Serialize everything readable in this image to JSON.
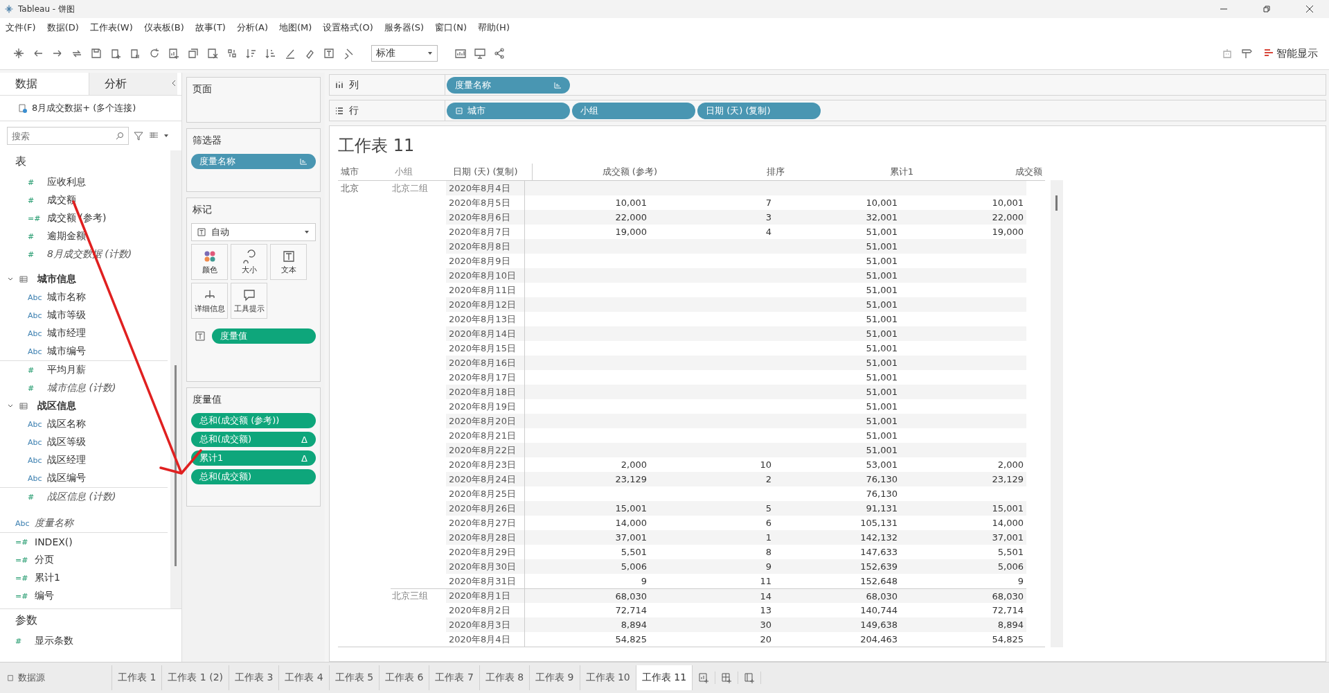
{
  "window": {
    "title": "Tableau - 饼图"
  },
  "menu": [
    "文件(F)",
    "数据(D)",
    "工作表(W)",
    "仪表板(B)",
    "故事(T)",
    "分析(A)",
    "地图(M)",
    "设置格式(O)",
    "服务器(S)",
    "窗口(N)",
    "帮助(H)"
  ],
  "toolbar": {
    "fit": "标准",
    "show_me": "智能显示"
  },
  "data_pane": {
    "tabs": [
      {
        "label": "数据",
        "selected": true
      },
      {
        "label": "分析",
        "selected": false
      }
    ],
    "source": "8月成交数据+ (多个连接)",
    "search": {
      "placeholder": "搜索"
    },
    "section": "表",
    "fields": [
      {
        "kind": "measure",
        "icon": "#",
        "label": "应收利息",
        "generated": false
      },
      {
        "kind": "measure",
        "icon": "#",
        "label": "成交额",
        "generated": false
      },
      {
        "kind": "calc",
        "icon": "=#",
        "label": "成交额 (参考)",
        "generated": false
      },
      {
        "kind": "measure",
        "icon": "#",
        "label": "逾期金额",
        "generated": false
      },
      {
        "kind": "measure",
        "icon": "#",
        "label": "8月成交数据 (计数)",
        "generated": true
      },
      {
        "kind": "folder",
        "label": "城市信息",
        "expanded": true,
        "children": [
          {
            "kind": "dimension",
            "icon": "Abc",
            "label": "城市名称",
            "generated": false
          },
          {
            "kind": "dimension",
            "icon": "Abc",
            "label": "城市等级",
            "generated": false
          },
          {
            "kind": "dimension",
            "icon": "Abc",
            "label": "城市经理",
            "generated": false
          },
          {
            "kind": "dimension",
            "icon": "Abc",
            "label": "城市编号",
            "generated": false
          },
          {
            "kind": "measure",
            "icon": "#",
            "label": "平均月薪",
            "generated": false
          },
          {
            "kind": "measure",
            "icon": "#",
            "label": "城市信息 (计数)",
            "generated": true
          }
        ]
      },
      {
        "kind": "folder",
        "label": "战区信息",
        "expanded": true,
        "children": [
          {
            "kind": "dimension",
            "icon": "Abc",
            "label": "战区名称",
            "generated": false
          },
          {
            "kind": "dimension",
            "icon": "Abc",
            "label": "战区等级",
            "generated": false
          },
          {
            "kind": "dimension",
            "icon": "Abc",
            "label": "战区经理",
            "generated": false
          },
          {
            "kind": "dimension",
            "icon": "Abc",
            "label": "战区编号",
            "generated": false
          },
          {
            "kind": "measure",
            "icon": "#",
            "label": "战区信息 (计数)",
            "generated": true
          }
        ]
      }
    ],
    "extra_fields": [
      {
        "kind": "dimension",
        "icon": "Abc",
        "label": "度量名称",
        "generated": true
      },
      {
        "kind": "calc",
        "icon": "=#",
        "label": "INDEX()",
        "generated": false
      },
      {
        "kind": "calc",
        "icon": "=#",
        "label": "分页",
        "generated": false
      },
      {
        "kind": "calc",
        "icon": "=#",
        "label": "累计1",
        "generated": false
      },
      {
        "kind": "calc",
        "icon": "=#",
        "label": "编号",
        "generated": false
      }
    ],
    "params_title": "参数",
    "params": [
      {
        "kind": "measure",
        "icon": "#",
        "label": "显示条数"
      }
    ]
  },
  "cards": {
    "pages": {
      "title": "页面"
    },
    "filters": {
      "title": "筛选器",
      "pills": [
        {
          "label": "度量名称",
          "kind": "discrete",
          "sorted": true
        }
      ]
    },
    "marks": {
      "title": "标记",
      "type": "自动",
      "buttons": [
        {
          "kind": "color",
          "label": "颜色"
        },
        {
          "kind": "size",
          "label": "大小"
        },
        {
          "kind": "text",
          "label": "文本"
        },
        {
          "kind": "detail",
          "label": "详细信息"
        },
        {
          "kind": "tooltip",
          "label": "工具提示"
        }
      ],
      "pills": [
        {
          "label": "度量值",
          "kind": "continuous"
        }
      ]
    },
    "measure_values": {
      "title": "度量值",
      "pills": [
        {
          "label": "总和(成交额 (参考))"
        },
        {
          "label": "总和(成交额)",
          "flag": "Δ"
        },
        {
          "label": "累计1",
          "flag": "Δ"
        },
        {
          "label": "总和(成交额)"
        }
      ]
    }
  },
  "shelves": [
    {
      "label": "列",
      "kind": "columns",
      "pills": [
        {
          "label": "度量名称",
          "kind": "discrete",
          "sorted": true,
          "collapsible": false
        }
      ]
    },
    {
      "label": "行",
      "kind": "rows",
      "pills": [
        {
          "label": "城市",
          "kind": "discrete",
          "sorted": false,
          "collapsible": true
        },
        {
          "label": "小组",
          "kind": "discrete",
          "sorted": false,
          "collapsible": false
        },
        {
          "label": "日期 (天) (复制)",
          "kind": "discrete",
          "sorted": false,
          "collapsible": false
        }
      ]
    }
  ],
  "view": {
    "title": "工作表 11",
    "columns": [
      "城市",
      "小组",
      "日期 (天) (复制)",
      "成交额 (参考)",
      "排序",
      "累计1",
      "成交额"
    ],
    "cities": [
      {
        "name": "北京",
        "groups": [
          {
            "name": "北京二组",
            "rows": [
              {
                "date": "2020年8月4日"
              },
              {
                "date": "2020年8月5日",
                "reference": "10,001",
                "rank": "7",
                "cumulative": "10,001",
                "amount": "10,001"
              },
              {
                "date": "2020年8月6日",
                "reference": "22,000",
                "rank": "3",
                "cumulative": "32,001",
                "amount": "22,000"
              },
              {
                "date": "2020年8月7日",
                "reference": "19,000",
                "rank": "4",
                "cumulative": "51,001",
                "amount": "19,000"
              },
              {
                "date": "2020年8月8日",
                "cumulative": "51,001"
              },
              {
                "date": "2020年8月9日",
                "cumulative": "51,001"
              },
              {
                "date": "2020年8月10日",
                "cumulative": "51,001"
              },
              {
                "date": "2020年8月11日",
                "cumulative": "51,001"
              },
              {
                "date": "2020年8月12日",
                "cumulative": "51,001"
              },
              {
                "date": "2020年8月13日",
                "cumulative": "51,001"
              },
              {
                "date": "2020年8月14日",
                "cumulative": "51,001"
              },
              {
                "date": "2020年8月15日",
                "cumulative": "51,001"
              },
              {
                "date": "2020年8月16日",
                "cumulative": "51,001"
              },
              {
                "date": "2020年8月17日",
                "cumulative": "51,001"
              },
              {
                "date": "2020年8月18日",
                "cumulative": "51,001"
              },
              {
                "date": "2020年8月19日",
                "cumulative": "51,001"
              },
              {
                "date": "2020年8月20日",
                "cumulative": "51,001"
              },
              {
                "date": "2020年8月21日",
                "cumulative": "51,001"
              },
              {
                "date": "2020年8月22日",
                "cumulative": "51,001"
              },
              {
                "date": "2020年8月23日",
                "reference": "2,000",
                "rank": "10",
                "cumulative": "53,001",
                "amount": "2,000"
              },
              {
                "date": "2020年8月24日",
                "reference": "23,129",
                "rank": "2",
                "cumulative": "76,130",
                "amount": "23,129"
              },
              {
                "date": "2020年8月25日",
                "cumulative": "76,130"
              },
              {
                "date": "2020年8月26日",
                "reference": "15,001",
                "rank": "5",
                "cumulative": "91,131",
                "amount": "15,001"
              },
              {
                "date": "2020年8月27日",
                "reference": "14,000",
                "rank": "6",
                "cumulative": "105,131",
                "amount": "14,000"
              },
              {
                "date": "2020年8月28日",
                "reference": "37,001",
                "rank": "1",
                "cumulative": "142,132",
                "amount": "37,001"
              },
              {
                "date": "2020年8月29日",
                "reference": "5,501",
                "rank": "8",
                "cumulative": "147,633",
                "amount": "5,501"
              },
              {
                "date": "2020年8月30日",
                "reference": "5,006",
                "rank": "9",
                "cumulative": "152,639",
                "amount": "5,006"
              },
              {
                "date": "2020年8月31日",
                "reference": "9",
                "rank": "11",
                "cumulative": "152,648",
                "amount": "9"
              }
            ]
          },
          {
            "name": "北京三组",
            "rows": [
              {
                "date": "2020年8月1日",
                "reference": "68,030",
                "rank": "14",
                "cumulative": "68,030",
                "amount": "68,030"
              },
              {
                "date": "2020年8月2日",
                "reference": "72,714",
                "rank": "13",
                "cumulative": "140,744",
                "amount": "72,714"
              },
              {
                "date": "2020年8月3日",
                "reference": "8,894",
                "rank": "30",
                "cumulative": "149,638",
                "amount": "8,894"
              },
              {
                "date": "2020年8月4日",
                "reference": "54,825",
                "rank": "20",
                "cumulative": "204,463",
                "amount": "54,825"
              }
            ]
          }
        ]
      }
    ]
  },
  "bottom": {
    "datasource": "数据源",
    "sheets": [
      {
        "label": "工作表 1",
        "selected": false
      },
      {
        "label": "工作表 1 (2)",
        "selected": false
      },
      {
        "label": "工作表 3",
        "selected": false
      },
      {
        "label": "工作表 4",
        "selected": false
      },
      {
        "label": "工作表 5",
        "selected": false
      },
      {
        "label": "工作表 6",
        "selected": false
      },
      {
        "label": "工作表 7",
        "selected": false
      },
      {
        "label": "工作表 8",
        "selected": false
      },
      {
        "label": "工作表 9",
        "selected": false
      },
      {
        "label": "工作表 10",
        "selected": false
      },
      {
        "label": "工作表 11",
        "selected": true
      }
    ]
  }
}
